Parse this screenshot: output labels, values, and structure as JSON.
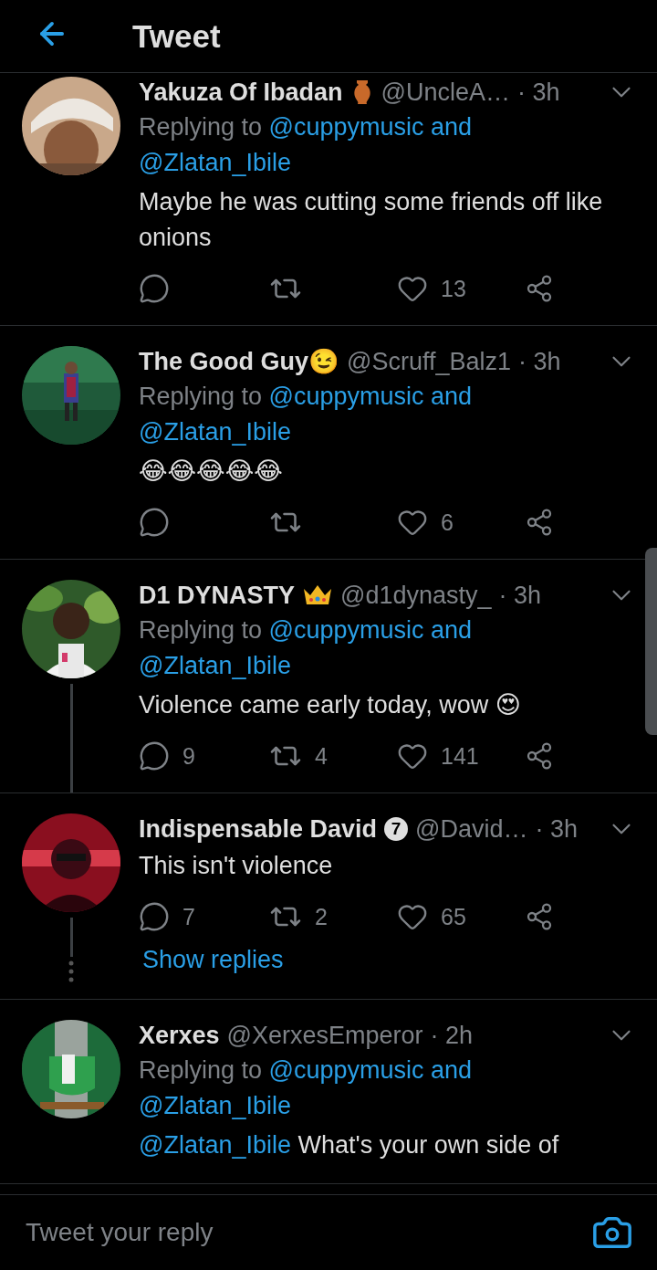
{
  "header": {
    "title": "Tweet"
  },
  "tweets": [
    {
      "name": "Yakuza Of Ibadan",
      "badge": {
        "kind": "vase"
      },
      "handle": "@UncleA…",
      "time": "· 3h",
      "replying_prefix": "Replying to",
      "mentions": [
        "@cuppymusic and",
        "@Zlatan_Ibile"
      ],
      "body": "Maybe he was cutting some friends off like onions",
      "actions": {
        "likes": "13"
      },
      "thread_line": false
    },
    {
      "name": "The Good Guy😉",
      "handle": "@Scruff_Balz1",
      "time": "· 3h",
      "replying_prefix": "Replying to",
      "mentions": [
        "@cuppymusic and",
        "@Zlatan_Ibile"
      ],
      "body": "😂😂😂😂😂",
      "actions": {
        "likes": "6"
      },
      "thread_line": false
    },
    {
      "name": "D1 DYNASTY",
      "badge": {
        "kind": "crown"
      },
      "handle": "@d1dynasty_",
      "time": "· 3h",
      "replying_prefix": "Replying to",
      "mentions": [
        "@cuppymusic and",
        "@Zlatan_Ibile"
      ],
      "body": "Violence came early today, wow 😍",
      "actions": {
        "replies": "9",
        "retweets": "4",
        "likes": "141"
      },
      "thread_line": true
    },
    {
      "name": "Indispensable David",
      "badge": {
        "kind": "number",
        "text": "7"
      },
      "handle": "@David…",
      "time": "· 3h",
      "body": "This isn't violence",
      "actions": {
        "replies": "7",
        "retweets": "2",
        "likes": "65"
      },
      "thread_line": true,
      "show_replies": "Show replies"
    },
    {
      "name": "Xerxes",
      "handle": "@XerxesEmperor",
      "time": "· 2h",
      "replying_prefix": "Replying to",
      "mentions": [
        "@cuppymusic and",
        "@Zlatan_Ibile"
      ],
      "body_mention": "@Zlatan_Ibile",
      "body": "What's your own side of",
      "thread_line": false
    }
  ],
  "composer": {
    "placeholder": "Tweet your reply"
  }
}
